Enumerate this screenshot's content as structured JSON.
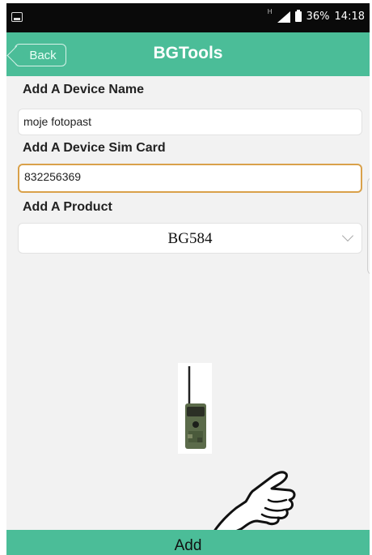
{
  "status_bar": {
    "network_type": "H",
    "battery": "36%",
    "time": "14:18"
  },
  "header": {
    "back_label": "Back",
    "title": "BGTools"
  },
  "form": {
    "device_name_label": "Add A Device Name",
    "device_name_value": "moje fotopast",
    "sim_card_label": "Add A Device Sim Card",
    "sim_card_value": "832256369",
    "product_label": "Add A Product",
    "product_selected": "BG584"
  },
  "footer": {
    "add_label": "Add"
  },
  "colors": {
    "accent": "#4bbd98",
    "active_border": "#d9a14a"
  },
  "icons": {
    "status_left": "image-icon",
    "signal": "signal-icon",
    "battery": "battery-icon",
    "select": "chevron-down-icon",
    "pointer": "pointing-hand-icon"
  }
}
